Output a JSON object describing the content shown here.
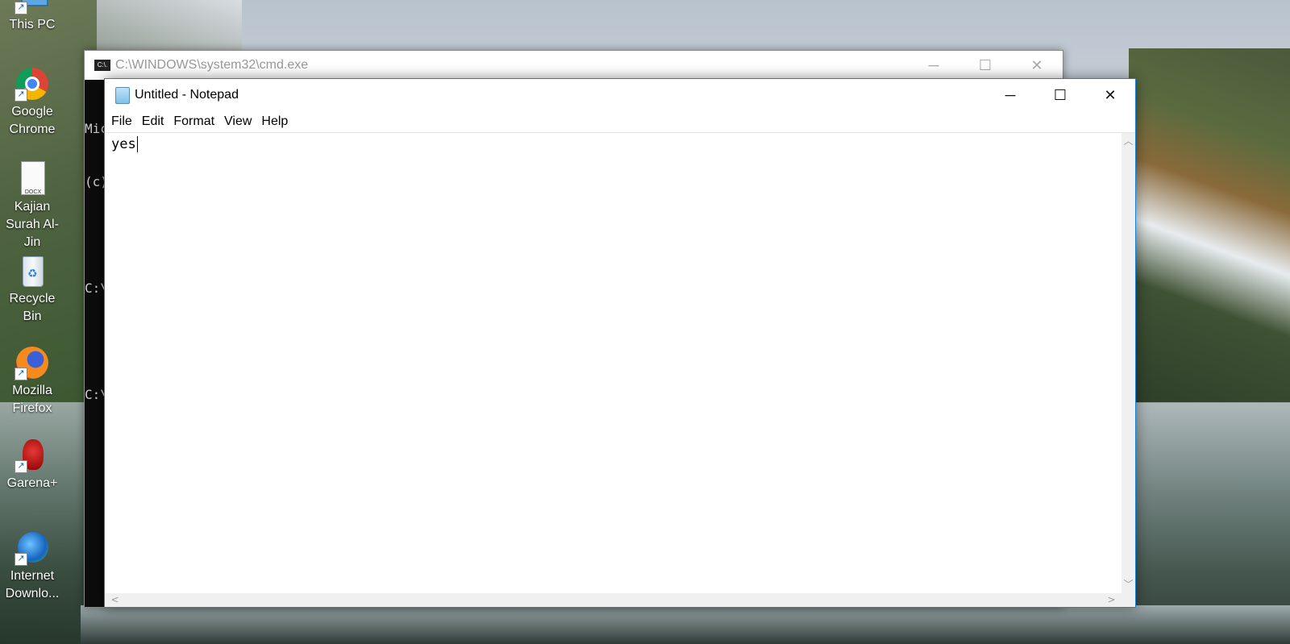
{
  "desktop": {
    "icons": [
      {
        "label": "This PC",
        "icon": "this-pc-icon"
      },
      {
        "label": "Google Chrome",
        "icon": "chrome-icon"
      },
      {
        "label": "Kajian Surah Al-Jin",
        "icon": "docx-file-icon",
        "badge": "DOCX"
      },
      {
        "label": "Recycle Bin",
        "icon": "recycle-bin-icon"
      },
      {
        "label": "Mozilla Firefox",
        "icon": "firefox-icon"
      },
      {
        "label": "Garena+",
        "icon": "garena-icon"
      },
      {
        "label": "Internet Downlo...",
        "icon": "internet-download-manager-icon"
      }
    ]
  },
  "cmd": {
    "title": "C:\\WINDOWS\\system32\\cmd.exe",
    "icon_text": "C:\\.",
    "lines": [
      "Mic",
      "(c)",
      "",
      "C:\\",
      "",
      "C:\\"
    ]
  },
  "notepad": {
    "title": "Untitled - Notepad",
    "menu": [
      "File",
      "Edit",
      "Format",
      "View",
      "Help"
    ],
    "content": "yes",
    "controls": {
      "minimize": "─",
      "maximize": "☐",
      "close": "✕"
    }
  },
  "colors": {
    "accent_border": "#1883d7",
    "cmd_background": "#0c0c0c"
  }
}
